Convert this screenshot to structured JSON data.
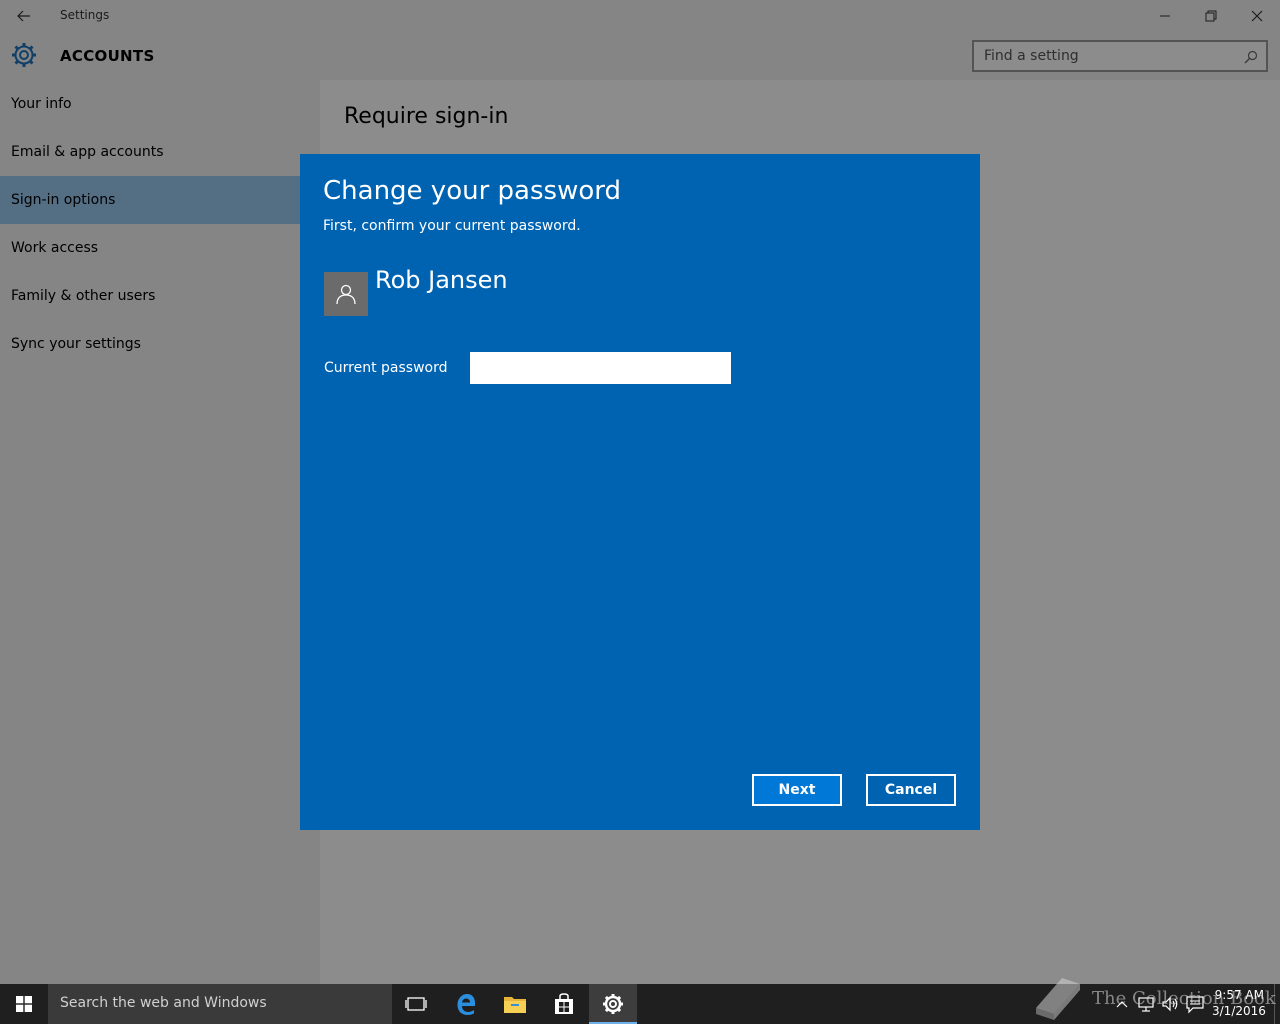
{
  "window": {
    "title": "Settings",
    "header_title": "ACCOUNTS",
    "search_placeholder": "Find a setting"
  },
  "sidebar": {
    "items": [
      {
        "label": "Your info",
        "selected": false
      },
      {
        "label": "Email & app accounts",
        "selected": false
      },
      {
        "label": "Sign-in options",
        "selected": true
      },
      {
        "label": "Work access",
        "selected": false
      },
      {
        "label": "Family & other users",
        "selected": false
      },
      {
        "label": "Sync your settings",
        "selected": false
      }
    ]
  },
  "content": {
    "heading": "Require sign-in"
  },
  "dialog": {
    "title": "Change your password",
    "subtitle": "First, confirm your current password.",
    "user_name": "Rob Jansen",
    "password_label": "Current password",
    "password_value": "",
    "next_label": "Next",
    "cancel_label": "Cancel"
  },
  "taskbar": {
    "search_placeholder": "Search the web and Windows",
    "time": "9:57 AM",
    "date": "3/1/2016",
    "icons": [
      "task-view-icon",
      "edge-icon",
      "file-explorer-icon",
      "store-icon",
      "settings-icon"
    ]
  },
  "watermark": {
    "text": "The Collection Book"
  },
  "colors": {
    "dialog_bg": "#0063b1",
    "next_button_bg": "#0078d7",
    "selected_nav_bg": "#99c8f0",
    "taskbar_bg": "#1f1f1f"
  }
}
